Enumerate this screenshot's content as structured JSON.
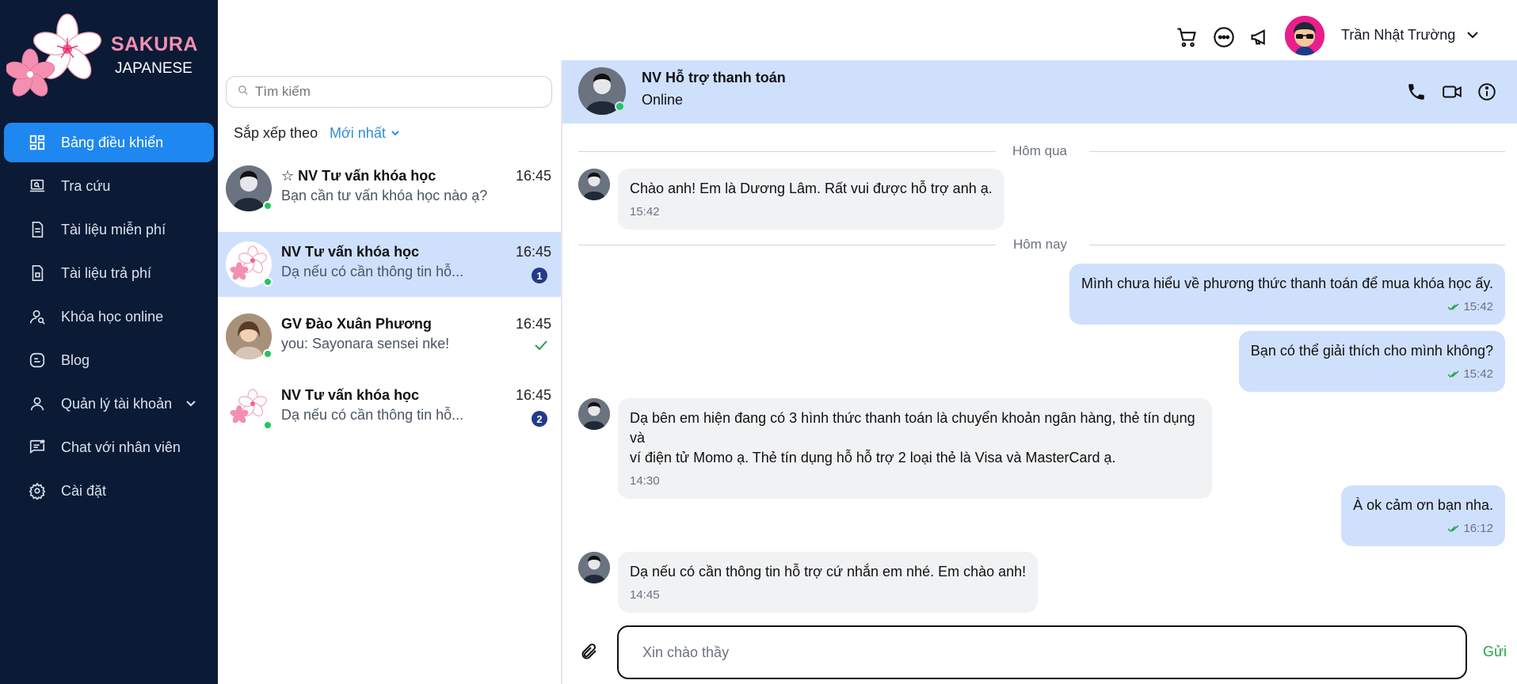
{
  "brand": {
    "line1": "SAKURA",
    "line2": "JAPANESE"
  },
  "sidebar": {
    "items": [
      {
        "label": "Bảng điều khiển",
        "icon": "dashboard-icon",
        "active": true
      },
      {
        "label": "Tra cứu",
        "icon": "laptop-search-icon"
      },
      {
        "label": "Tài liệu miễn phí",
        "icon": "document-icon"
      },
      {
        "label": "Tài liệu trả phí",
        "icon": "paid-document-icon"
      },
      {
        "label": "Khóa học online",
        "icon": "user-course-icon"
      },
      {
        "label": "Blog",
        "icon": "blog-icon"
      },
      {
        "label": "Quản lý tài khoản",
        "icon": "user-icon",
        "has_chevron": true
      },
      {
        "label": "Chat với nhân viên",
        "icon": "chat-icon"
      },
      {
        "label": "Cài đặt",
        "icon": "gear-icon"
      }
    ]
  },
  "header": {
    "icons": [
      "cart-icon",
      "message-icon",
      "megaphone-icon"
    ],
    "user_name": "Trần Nhật Trường"
  },
  "conversations": {
    "search_placeholder": "Tìm kiếm",
    "sort_label": "Sắp xếp theo",
    "sort_value": "Mới nhất",
    "items": [
      {
        "pin": "☆",
        "name": "NV Tư vấn khóa học",
        "preview": "Bạn cần tư vấn khóa học nào ạ?",
        "time": "16:45",
        "badge": null,
        "avatar": "man-photo"
      },
      {
        "name": "NV Tư vấn khóa học",
        "preview": "Dạ nếu có cần thông tin hỗ...",
        "time": "16:45",
        "badge": "1",
        "avatar": "sakura-logo",
        "active": true
      },
      {
        "name": "GV Đào Xuân Phương",
        "preview": "you: Sayonara sensei nke!",
        "time": "16:45",
        "status": "read",
        "avatar": "woman-photo"
      },
      {
        "name": "NV Tư vấn khóa học",
        "preview": "Dạ nếu có cần thông tin hỗ...",
        "time": "16:45",
        "badge": "2",
        "avatar": "sakura-logo"
      }
    ]
  },
  "chat": {
    "contact_name": "NV Hỗ trợ thanh toán",
    "contact_status": "Online",
    "header_icons": [
      "phone-icon",
      "video-icon",
      "info-icon"
    ],
    "day_yesterday": "Hôm qua",
    "day_today": "Hôm nay",
    "messages": [
      {
        "dir": "in",
        "text": "Chào anh! Em là Dương Lâm. Rất vui được hỗ trợ anh ạ.",
        "time": "15:42"
      },
      {
        "dir": "out",
        "text": "Mình chưa hiểu về phương thức thanh toán để mua khóa học ấy.",
        "time": "15:42"
      },
      {
        "dir": "out",
        "text": "Bạn có thể giải thích cho mình không?",
        "time": "15:42"
      },
      {
        "dir": "in",
        "text_line1": "Dạ bên em hiện đang có 3 hình thức thanh toán là chuyển khoản ngân hàng, thẻ tín dụng và",
        "text_line2": "ví điện tử Momo ạ. Thẻ tín dụng hỗ hỗ trợ 2 loại thẻ là Visa và MasterCard ạ.",
        "time": "14:30"
      },
      {
        "dir": "out",
        "text": "À ok cảm ơn bạn nha.",
        "time": "16:12"
      },
      {
        "dir": "in",
        "text": "Dạ nếu có cần thông tin hỗ trợ cứ nhắn em nhé. Em chào anh!",
        "time": "14:45"
      }
    ],
    "composer_value": "Xin chào thầy",
    "send_label": "Gửi"
  },
  "colors": {
    "sidebar_bg": "#0b1a35",
    "accent": "#1e88f0",
    "bubble_out": "#cfe0fd",
    "online": "#22c55e",
    "send": "#22a34a"
  }
}
